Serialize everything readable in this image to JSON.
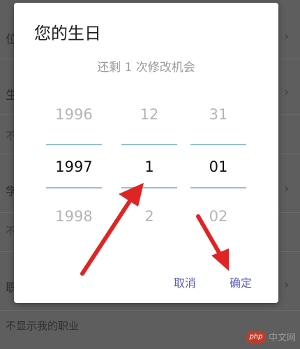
{
  "background": {
    "rows": [
      {
        "left": "位",
        "chevron": "›"
      },
      {
        "left": "生",
        "chevron": "›"
      },
      {
        "left": "不",
        "chevron": ""
      },
      {
        "left": "学",
        "chevron": "›"
      },
      {
        "left": "不",
        "chevron": ""
      },
      {
        "left": "职",
        "chevron": "›"
      }
    ],
    "footer_text": "不显示我的职业"
  },
  "watermark": {
    "logo": "php",
    "text": "中文网"
  },
  "dialog": {
    "title": "您的生日",
    "subtitle": "还剩 1 次修改机会",
    "picker": {
      "year": {
        "prev": "1996",
        "selected": "1997",
        "next": "1998"
      },
      "month": {
        "prev": "12",
        "selected": "1",
        "next": "2"
      },
      "day": {
        "prev": "31",
        "selected": "01",
        "next": "02"
      }
    },
    "cancel_label": "取消",
    "ok_label": "确定"
  },
  "colors": {
    "accent": "#5b5fb8",
    "divider": "#8ec3cf",
    "arrow": "#e02424",
    "overlay": "#5e5e5e"
  }
}
